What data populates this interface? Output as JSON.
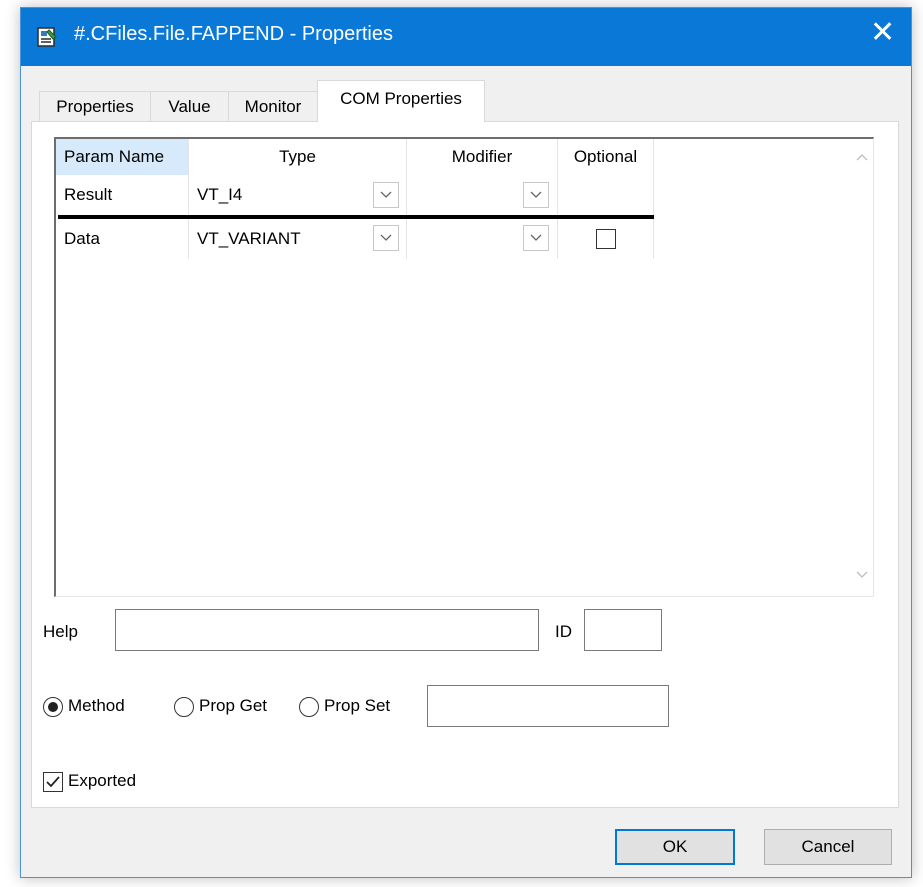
{
  "window": {
    "title": "#.CFiles.File.FAPPEND - Properties",
    "title_icon": "properties-sheet-icon",
    "close_glyph": "✕",
    "accent_color": "#0a78d7"
  },
  "tabs": [
    {
      "label": "Properties",
      "active": false
    },
    {
      "label": "Value",
      "active": false
    },
    {
      "label": "Monitor",
      "active": false
    },
    {
      "label": "COM Properties",
      "active": true
    }
  ],
  "grid": {
    "columns": [
      "Param Name",
      "Type",
      "Modifier",
      "Optional"
    ],
    "rows": [
      {
        "name": "Result",
        "type": "VT_I4",
        "modifier": "",
        "optional": null
      },
      {
        "name": "Data",
        "type": "VT_VARIANT",
        "modifier": "",
        "optional": false
      }
    ]
  },
  "form": {
    "help_label": "Help",
    "help_value": "",
    "id_label": "ID",
    "id_value": "",
    "radio_method": "Method",
    "radio_prop_get": "Prop Get",
    "radio_prop_set": "Prop Set",
    "selected_radio": "Method",
    "prop_field_value": "",
    "exported_label": "Exported",
    "exported_checked": true
  },
  "buttons": {
    "ok": "OK",
    "cancel": "Cancel"
  }
}
